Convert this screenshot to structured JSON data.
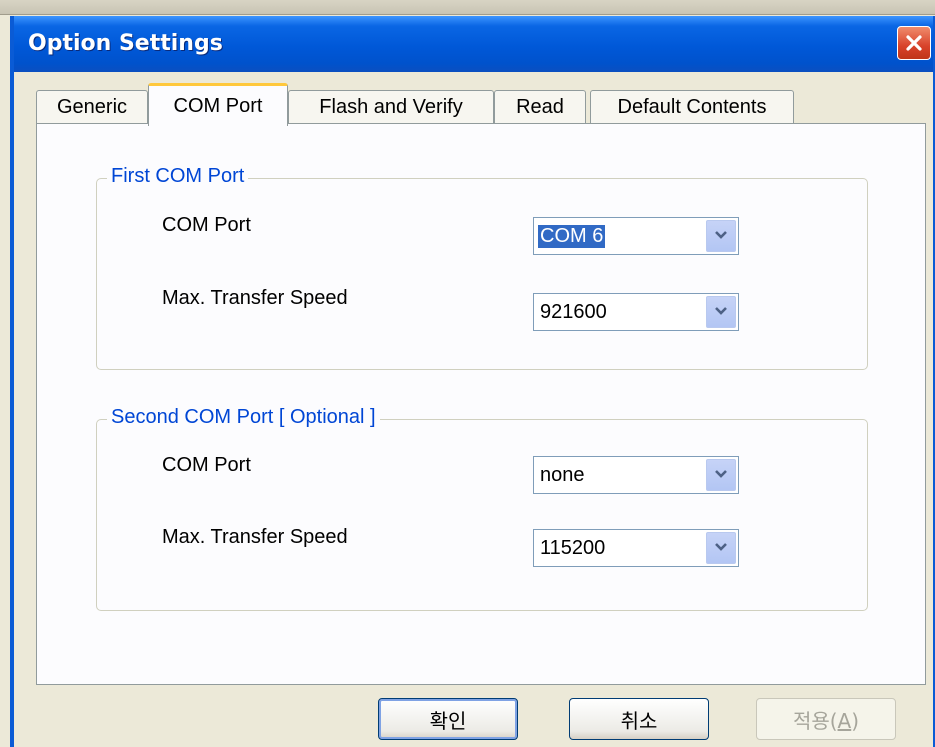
{
  "window": {
    "title": "Option Settings"
  },
  "tabs": [
    {
      "label": "Generic"
    },
    {
      "label": "COM Port"
    },
    {
      "label": "Flash and Verify"
    },
    {
      "label": "Read"
    },
    {
      "label": "Default Contents"
    }
  ],
  "active_tab": "COM Port",
  "first_group": {
    "title": "First COM Port",
    "com_port_label": "COM Port",
    "com_port_value": "COM 6",
    "speed_label": "Max. Transfer Speed",
    "speed_value": "921600"
  },
  "second_group": {
    "title": "Second COM Port [ Optional ]",
    "com_port_label": "COM Port",
    "com_port_value": "none",
    "speed_label": "Max. Transfer Speed",
    "speed_value": "115200"
  },
  "buttons": {
    "ok": "확인",
    "cancel": "취소",
    "apply_text": "적용(",
    "apply_mnemonic": "A",
    "apply_close": ")"
  },
  "colors": {
    "titlebar": "#0058d8",
    "group_label": "#0046d5",
    "selection": "#316ac5",
    "active_tab_accent": "#ffc83c"
  },
  "icons": {
    "close": "close-icon",
    "dropdown": "chevron-down-icon"
  }
}
